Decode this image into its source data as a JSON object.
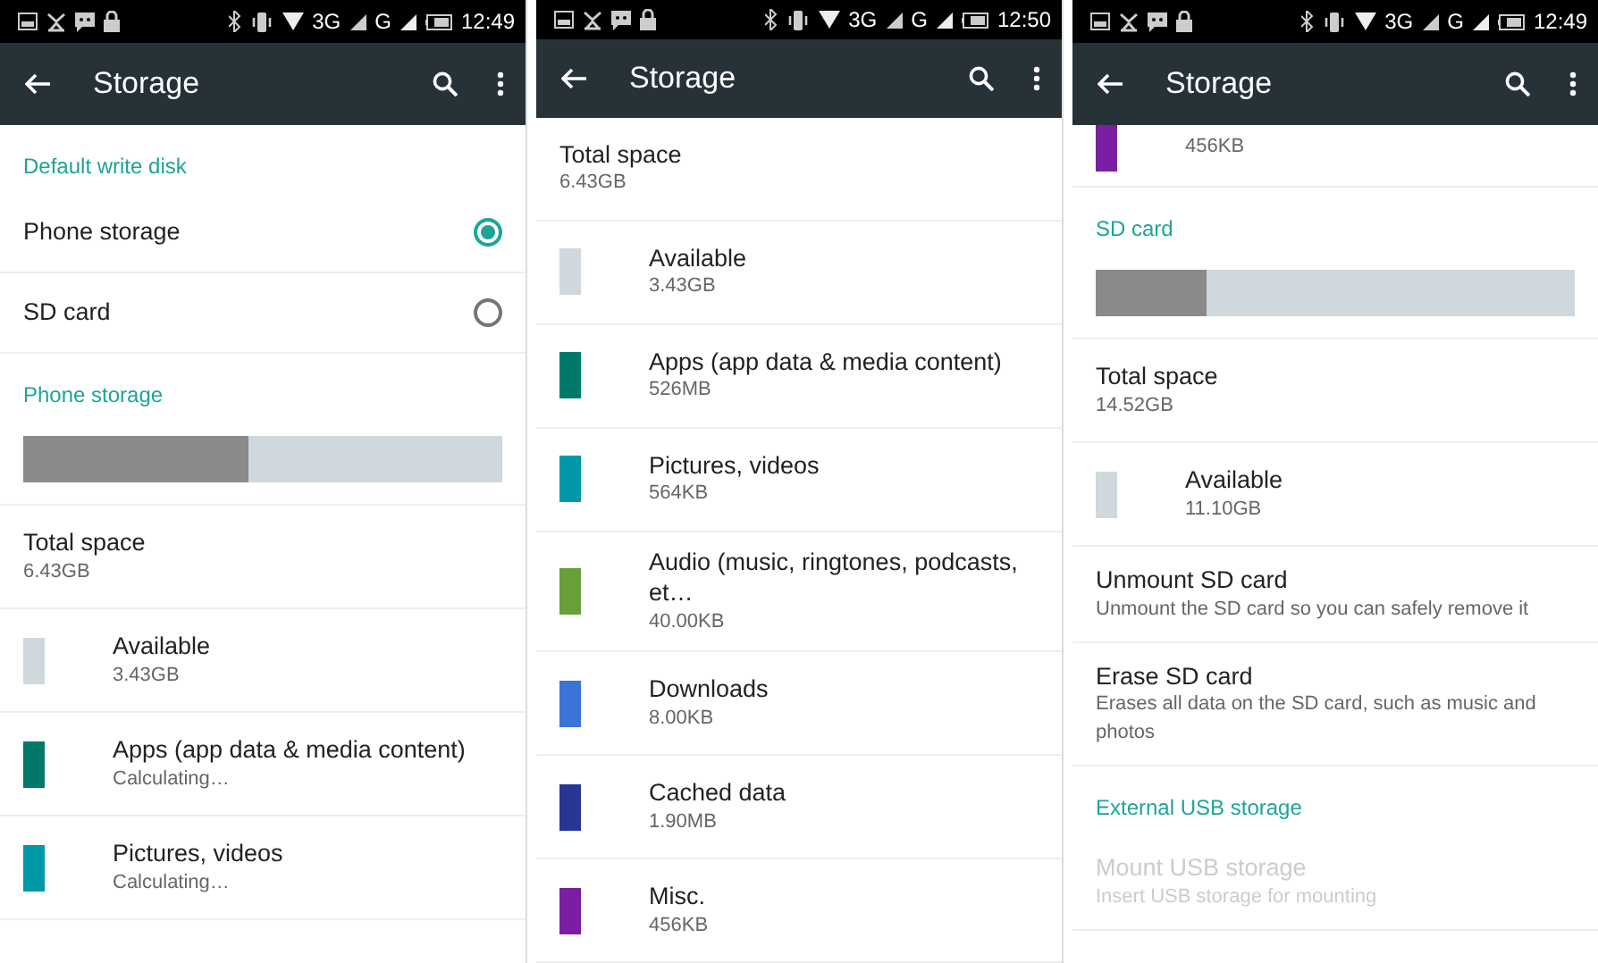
{
  "panels": [
    {
      "status_bar": {
        "network_1": "3G",
        "network_2": "G",
        "time": "12:49"
      },
      "app_bar": {
        "title": "Storage"
      },
      "items": [
        {
          "kind": "header",
          "title": "Default write disk"
        },
        {
          "kind": "radio",
          "title": "Phone storage",
          "selected": true
        },
        {
          "kind": "radio",
          "title": "SD card",
          "selected": false
        },
        {
          "kind": "header",
          "title": "Phone storage"
        },
        {
          "kind": "bar",
          "level": 0.47
        },
        {
          "kind": "entry",
          "title": "Total space",
          "value": "6.43GB"
        },
        {
          "kind": "entry",
          "title": "Available",
          "value": "3.43GB",
          "color": "#cfd8dc"
        },
        {
          "kind": "entry",
          "title": "Apps (app data & media content)",
          "value": "Calculating…",
          "color": "#00796b"
        },
        {
          "kind": "entry",
          "title": "Pictures, videos",
          "value": "Calculating…",
          "color": "#0097a7"
        }
      ]
    },
    {
      "status_bar": {
        "network_1": "3G",
        "network_2": "G",
        "time": "12:50"
      },
      "app_bar": {
        "title": "Storage"
      },
      "items": [
        {
          "kind": "entry",
          "title": "Total space",
          "value": "6.43GB"
        },
        {
          "kind": "entry",
          "title": "Available",
          "value": "3.43GB",
          "color": "#cfd8dc"
        },
        {
          "kind": "entry",
          "title": "Apps (app data & media content)",
          "value": "526MB",
          "color": "#00796b"
        },
        {
          "kind": "entry",
          "title": "Pictures, videos",
          "value": "564KB",
          "color": "#0097a7"
        },
        {
          "kind": "entry",
          "title": "Audio (music, ringtones, podcasts, et…",
          "value": "40.00KB",
          "color": "#689f38"
        },
        {
          "kind": "entry",
          "title": "Downloads",
          "value": "8.00KB",
          "color": "#3b73d9"
        },
        {
          "kind": "entry",
          "title": "Cached data",
          "value": "1.90MB",
          "color": "#283593"
        },
        {
          "kind": "entry",
          "title": "Misc.",
          "value": "456KB",
          "color": "#7b1fa2"
        }
      ]
    },
    {
      "status_bar": {
        "network_1": "3G",
        "network_2": "G",
        "time": "12:49"
      },
      "app_bar": {
        "title": "Storage"
      },
      "items": [
        {
          "kind": "entry",
          "value": "456KB",
          "color": "#7b1fa2"
        },
        {
          "kind": "header",
          "title": "SD card"
        },
        {
          "kind": "bar",
          "level": 0.23
        },
        {
          "kind": "entry",
          "title": "Total space",
          "value": "14.52GB"
        },
        {
          "kind": "entry",
          "title": "Available",
          "value": "11.10GB",
          "color": "#cfd8dc"
        },
        {
          "kind": "action",
          "title": "Unmount SD card",
          "subtitle": "Unmount the SD card so you can safely remove it",
          "disabled": false
        },
        {
          "kind": "action",
          "title": "Erase SD card",
          "subtitle": "Erases all data on the SD card, such as music and photos",
          "disabled": false
        },
        {
          "kind": "header",
          "title": "External USB storage"
        },
        {
          "kind": "action",
          "title": "Mount USB storage",
          "subtitle": "Insert USB storage for mounting",
          "disabled": true
        }
      ]
    }
  ]
}
